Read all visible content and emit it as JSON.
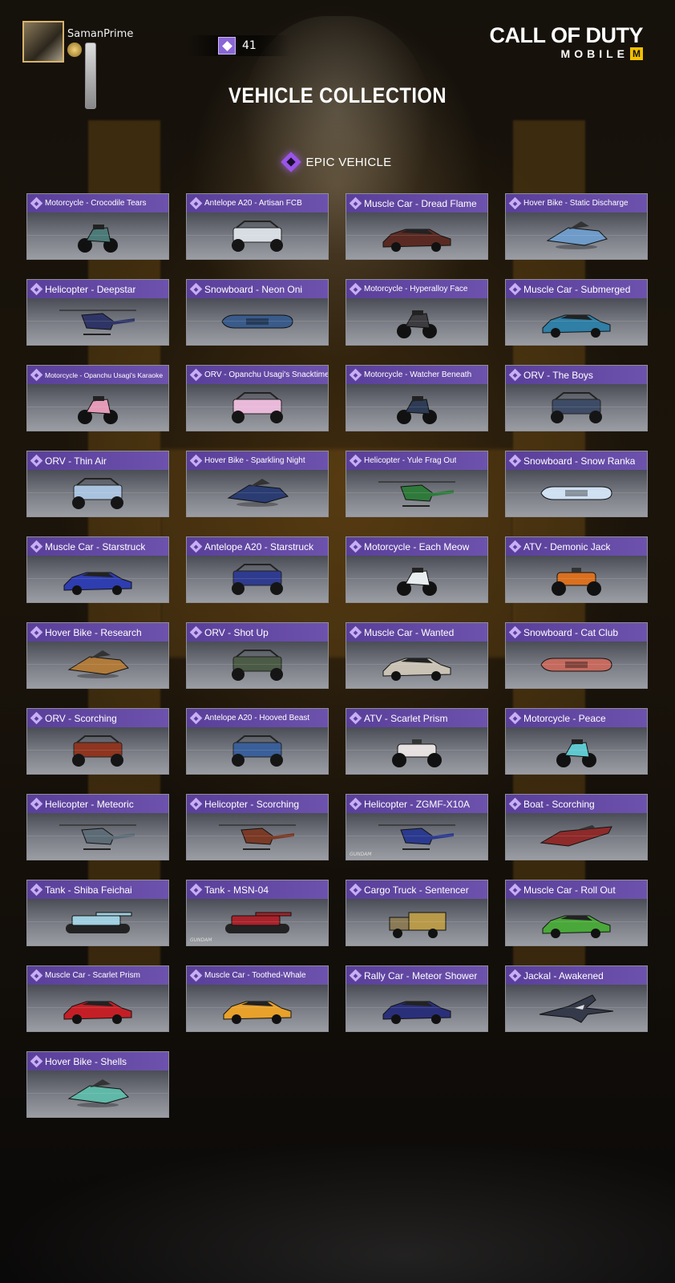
{
  "player": {
    "name": "SamanPrime"
  },
  "currency": {
    "icon": "vehicle-token-icon",
    "value": "41"
  },
  "logo": {
    "line1": "CALL OF DUTY",
    "line2": "MOBILE",
    "badge": "M"
  },
  "page_title": "VEHICLE COLLECTION",
  "section": {
    "label": "EPIC VEHICLE",
    "accent": "#9a54e8"
  },
  "colors": {
    "card_header": "#6d52ad",
    "card_body": "#7c7f87"
  },
  "vehicles": [
    {
      "name": "Motorcycle - Crocodile Tears",
      "kind": "motorcycle",
      "color": "#4c7a78"
    },
    {
      "name": "Antelope A20 - Artisan FCB",
      "kind": "buggy",
      "color": "#d8dde4"
    },
    {
      "name": "Muscle Car - Dread Flame",
      "kind": "car",
      "color": "#5a2a22"
    },
    {
      "name": "Hover Bike - Static Discharge",
      "kind": "hover",
      "color": "#6f9bc9"
    },
    {
      "name": "Helicopter - Deepstar",
      "kind": "heli",
      "color": "#2e3566"
    },
    {
      "name": "Snowboard - Neon Oni",
      "kind": "board",
      "color": "#3a5b8a"
    },
    {
      "name": "Motorcycle - Hyperalloy Face",
      "kind": "motorcycle",
      "color": "#3b3b40"
    },
    {
      "name": "Muscle Car - Submerged",
      "kind": "car",
      "color": "#2f7fa6"
    },
    {
      "name": "Motorcycle - Opanchu Usagi's Karaoke",
      "kind": "motorcycle",
      "color": "#e59ab8"
    },
    {
      "name": "ORV - Opanchu Usagi's Snacktime",
      "kind": "buggy",
      "color": "#e9b9da"
    },
    {
      "name": "Motorcycle - Watcher Beneath",
      "kind": "motorcycle",
      "color": "#2d3b55"
    },
    {
      "name": "ORV - The Boys",
      "kind": "buggy",
      "color": "#3d4b66"
    },
    {
      "name": "ORV - Thin Air",
      "kind": "buggy",
      "color": "#a9c3df"
    },
    {
      "name": "Hover Bike - Sparkling Night",
      "kind": "hover",
      "color": "#2a3c72"
    },
    {
      "name": "Helicopter - Yule Frag Out",
      "kind": "heli",
      "color": "#2f7a3b"
    },
    {
      "name": "Snowboard - Snow Ranka",
      "kind": "board",
      "color": "#cfe0f2"
    },
    {
      "name": "Muscle Car - Starstruck",
      "kind": "car",
      "color": "#2e3db0"
    },
    {
      "name": "Antelope A20 - Starstruck",
      "kind": "buggy",
      "color": "#2f3b8f"
    },
    {
      "name": "Motorcycle - Each Meow",
      "kind": "motorcycle",
      "color": "#e8eef0"
    },
    {
      "name": "ATV - Demonic Jack",
      "kind": "atv",
      "color": "#d9701f"
    },
    {
      "name": "Hover Bike - Research",
      "kind": "hover",
      "color": "#b07a3a"
    },
    {
      "name": "ORV - Shot Up",
      "kind": "buggy",
      "color": "#4b5b45"
    },
    {
      "name": "Muscle Car - Wanted",
      "kind": "car",
      "color": "#c9c2b5"
    },
    {
      "name": "Snowboard - Cat Club",
      "kind": "board",
      "color": "#c56a5e"
    },
    {
      "name": "ORV - Scorching",
      "kind": "buggy",
      "color": "#8f3520"
    },
    {
      "name": "Antelope A20 - Hooved Beast",
      "kind": "buggy",
      "color": "#3a5f9a"
    },
    {
      "name": "ATV - Scarlet Prism",
      "kind": "atv",
      "color": "#e6e0e0"
    },
    {
      "name": "Motorcycle - Peace",
      "kind": "motorcycle",
      "color": "#5fc9d0"
    },
    {
      "name": "Helicopter - Meteoric",
      "kind": "heli",
      "color": "#5d6b76"
    },
    {
      "name": "Helicopter - Scorching",
      "kind": "heli",
      "color": "#7a3a26"
    },
    {
      "name": "Helicopter - ZGMF-X10A",
      "kind": "heli",
      "color": "#2b3a8f",
      "tag": "GUNDAM"
    },
    {
      "name": "Boat - Scorching",
      "kind": "boat",
      "color": "#8e2a2a"
    },
    {
      "name": "Tank - Shiba Feichai",
      "kind": "tank",
      "color": "#9fcfe0"
    },
    {
      "name": "Tank - MSN-04",
      "kind": "tank",
      "color": "#a8222a",
      "tag": "GUNDAM"
    },
    {
      "name": "Cargo Truck - Sentencer",
      "kind": "truck",
      "color": "#b89a4a"
    },
    {
      "name": "Muscle Car - Roll Out",
      "kind": "car",
      "color": "#4aa83a"
    },
    {
      "name": "Muscle Car - Scarlet Prism",
      "kind": "car",
      "color": "#c41f26"
    },
    {
      "name": "Muscle Car - Toothed-Whale",
      "kind": "car",
      "color": "#e8a12a"
    },
    {
      "name": "Rally Car - Meteor Shower",
      "kind": "car",
      "color": "#2a2f7a"
    },
    {
      "name": "Jackal - Awakened",
      "kind": "jet",
      "color": "#353a4a"
    },
    {
      "name": "Hover Bike - Shells",
      "kind": "hover",
      "color": "#5fb8a8"
    }
  ]
}
